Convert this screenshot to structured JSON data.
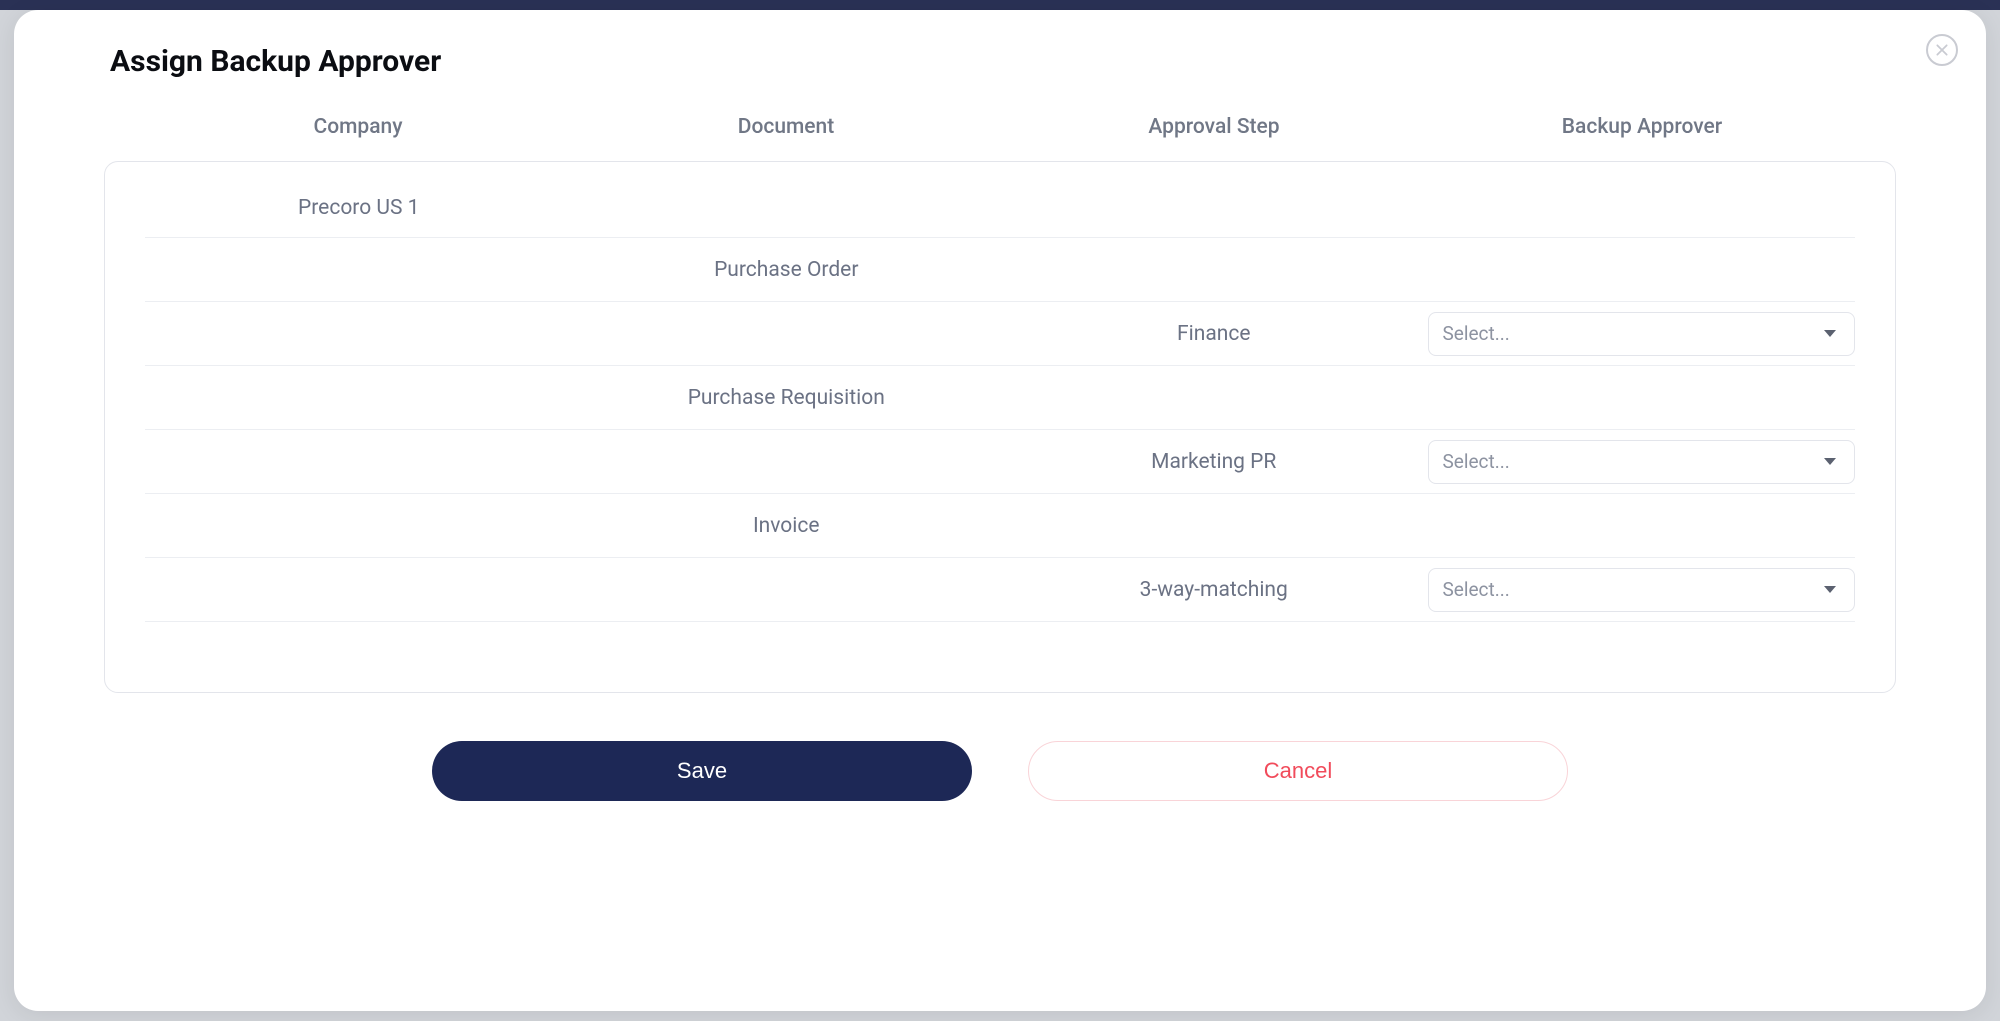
{
  "modal": {
    "title": "Assign Backup Approver",
    "headers": {
      "company": "Company",
      "document": "Document",
      "approval_step": "Approval Step",
      "backup_approver": "Backup Approver"
    },
    "rows": {
      "company": "Precoro US 1",
      "doc_po": "Purchase Order",
      "step_finance": "Finance",
      "doc_pr": "Purchase Requisition",
      "step_marketing_pr": "Marketing PR",
      "doc_invoice": "Invoice",
      "step_3way": "3-way-matching"
    },
    "select_placeholder": "Select...",
    "buttons": {
      "save": "Save",
      "cancel": "Cancel"
    }
  }
}
